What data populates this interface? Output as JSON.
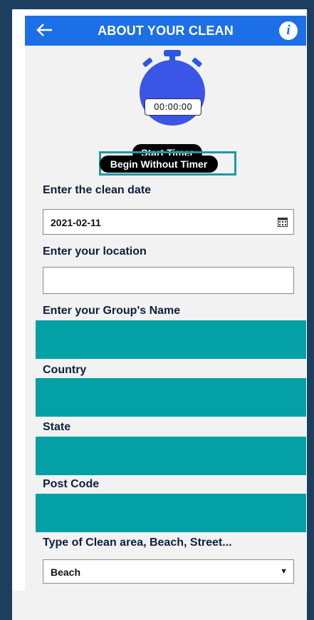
{
  "header": {
    "title": "ABOUT YOUR CLEAN",
    "back_icon": "arrow-left-icon",
    "info_icon": "info-icon",
    "info_glyph": "i",
    "color": "#1d6fe8"
  },
  "timer": {
    "display": "00:00:00",
    "start_label": "Start Timer",
    "begin_without_label": "Begin Without Timer"
  },
  "form": {
    "date_label": "Enter the clean date",
    "date_value": "2021-02-11",
    "location_label": "Enter your location",
    "location_value": "",
    "group_label": "Enter your Group's Name",
    "country_label": "Country",
    "state_label": "State",
    "postcode_label": "Post Code",
    "clean_area_label": "Type of Clean area, Beach, Street...",
    "clean_area_value": "Beach"
  },
  "colors": {
    "accent": "#1d6fe8",
    "teal": "#03a0a6",
    "highlight_border": "#1d9aa3"
  }
}
